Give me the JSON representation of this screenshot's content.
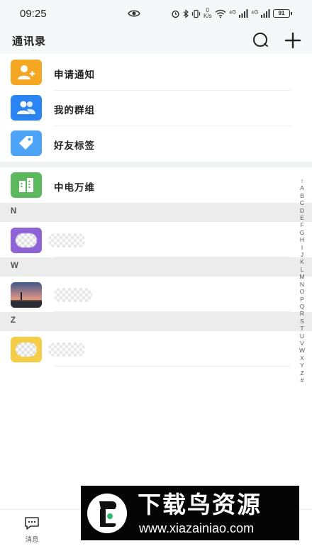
{
  "status_bar": {
    "time": "09:25",
    "speed_top": "0",
    "speed_bottom": "K/s",
    "signal1": "⁴ᴳ",
    "signal2": "⁴ᴳ",
    "battery": "91"
  },
  "header": {
    "title": "通讯录",
    "search_icon": "search-bubble-icon",
    "add_icon": "plus-icon"
  },
  "menu": [
    {
      "label": "申请通知",
      "icon": "user-add-icon",
      "color": "#f5a623"
    },
    {
      "label": "我的群组",
      "icon": "group-icon",
      "color": "#2b84f4"
    },
    {
      "label": "好友标签",
      "icon": "tag-icon",
      "color": "#4da3f6"
    }
  ],
  "organization": {
    "label": "中电万维",
    "icon": "building-icon",
    "color": "#5cb85c"
  },
  "sections": [
    {
      "letter": "N",
      "contact_avatar": "purple-blurred-avatar"
    },
    {
      "letter": "W",
      "contact_avatar": "sunset-photo-avatar"
    },
    {
      "letter": "Z",
      "contact_avatar": "yellow-blurred-avatar"
    }
  ],
  "index_letters": [
    "↑",
    "A",
    "B",
    "C",
    "D",
    "E",
    "F",
    "G",
    "H",
    "I",
    "J",
    "K",
    "L",
    "M",
    "N",
    "O",
    "P",
    "Q",
    "R",
    "S",
    "T",
    "U",
    "V",
    "W",
    "X",
    "Y",
    "Z",
    "#"
  ],
  "bottom_nav": [
    {
      "label": "消息",
      "icon": "chat-icon"
    },
    {
      "label": "",
      "icon": "workbench-icon"
    },
    {
      "label": "",
      "icon": "contacts-icon"
    },
    {
      "label": "",
      "icon": "me-icon"
    }
  ],
  "watermark": {
    "title": "下载鸟资源",
    "url": "www.xiazainiao.com"
  }
}
